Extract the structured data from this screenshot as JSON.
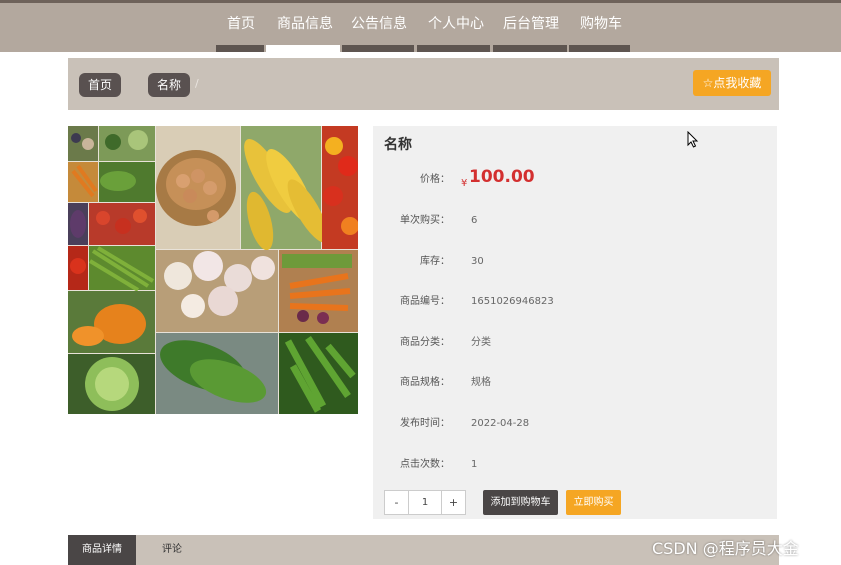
{
  "nav": {
    "items": [
      "首页",
      "商品信息",
      "公告信息",
      "个人中心",
      "后台管理",
      "购物车"
    ],
    "active": 1
  },
  "breadcrumb": {
    "home": "首页",
    "separator": "/",
    "current": "名称"
  },
  "favorite_button": "☆点我收藏",
  "product": {
    "title": "名称",
    "price_label": "价格：",
    "currency": "¥",
    "price": "100.00",
    "fields": [
      {
        "label": "单次购买：",
        "value": "6"
      },
      {
        "label": "库存：",
        "value": "30"
      },
      {
        "label": "商品编号：",
        "value": "1651026946823"
      },
      {
        "label": "商品分类：",
        "value": "分类"
      },
      {
        "label": "商品规格：",
        "value": "规格"
      },
      {
        "label": "发布时间：",
        "value": "2022-04-28"
      },
      {
        "label": "点击次数：",
        "value": "1"
      }
    ]
  },
  "quantity": {
    "minus": "-",
    "value": "1",
    "plus": "+"
  },
  "add_to_cart": "添加到购物车",
  "buy_now": "立即购买",
  "tabs": [
    "商品详情",
    "评论"
  ],
  "watermark": "CSDN @程序员大金",
  "colors": {
    "nav_bg": "#b3a89e",
    "accent_orange": "#f5a623",
    "dark_button": "#4a4646",
    "price_red": "#d32f2f"
  }
}
